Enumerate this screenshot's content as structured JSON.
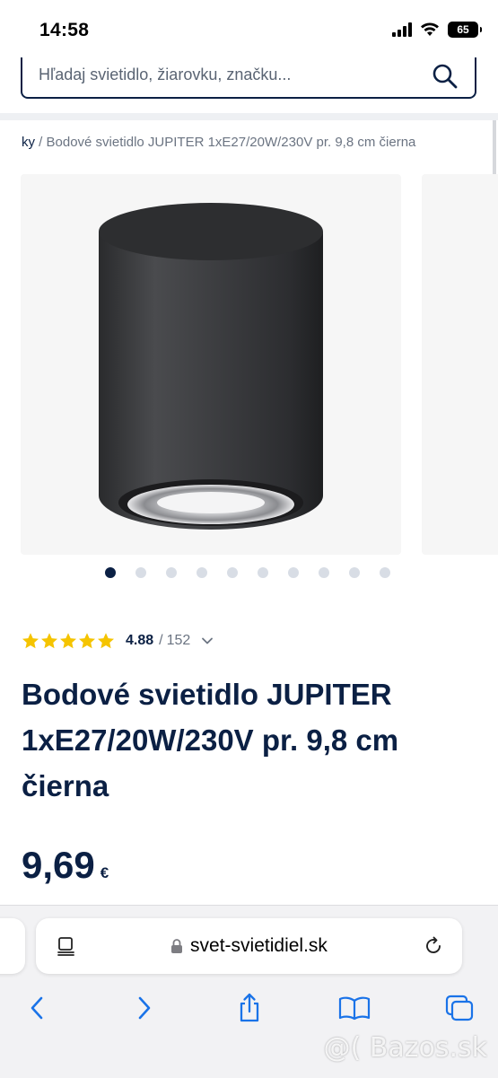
{
  "status": {
    "time": "14:58",
    "battery": "65"
  },
  "search": {
    "placeholder": "Hľadaj svietidlo, žiarovku, značku..."
  },
  "breadcrumb": {
    "link": "ky",
    "separator": "/",
    "current": "Bodové svietidlo JUPITER 1xE27/20W/230V pr. 9,8 cm čierna"
  },
  "gallery": {
    "active_index": 0,
    "dot_count": 10
  },
  "rating": {
    "stars": 5,
    "value": "4.88",
    "separator": "/",
    "count": "152"
  },
  "product": {
    "title": "Bodové svietidlo JUPITER 1xE27/20W/230V pr. 9,8 cm čierna",
    "price": "9,69",
    "currency": "€"
  },
  "browser": {
    "url": "svet-svietidiel.sk"
  },
  "watermark": "@( Bazos.sk",
  "colors": {
    "brand_navy": "#0b2044",
    "star": "#f5c400",
    "dot_inactive": "#d8dde5"
  }
}
